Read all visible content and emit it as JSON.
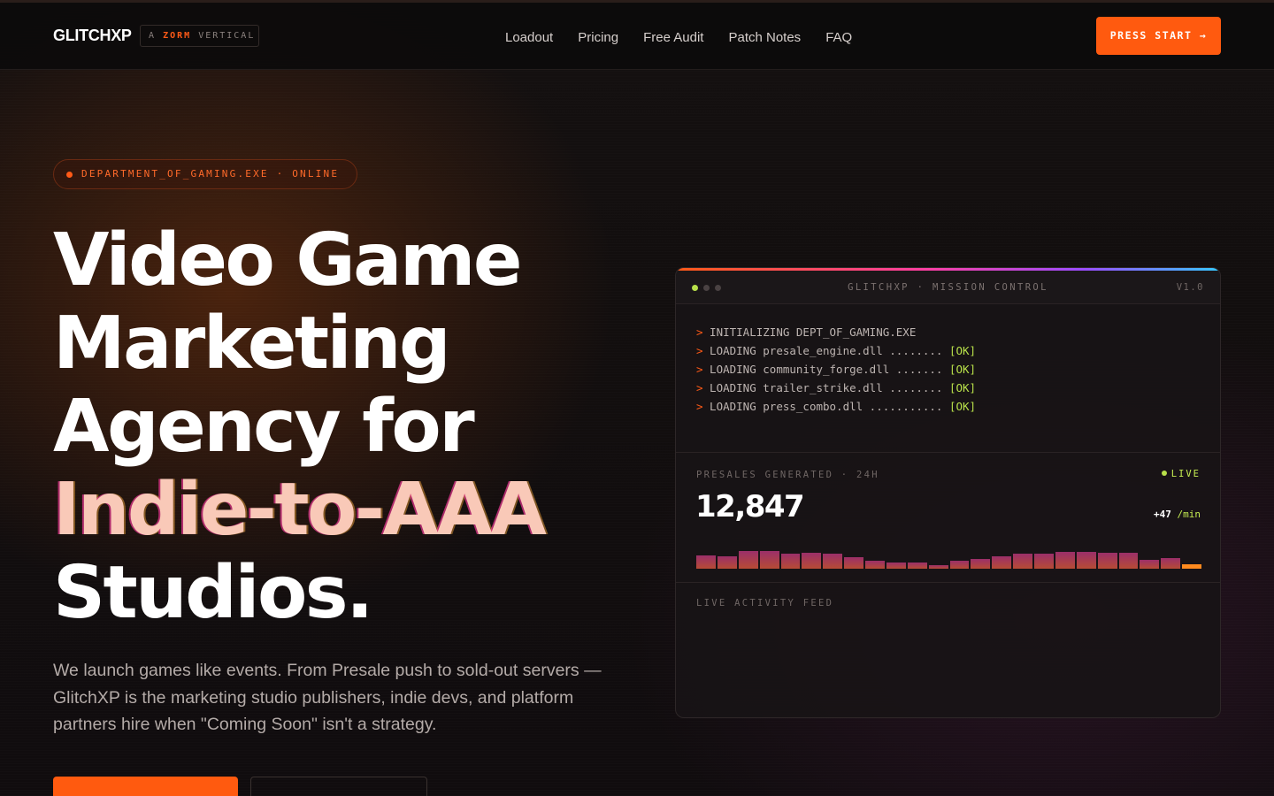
{
  "nav": {
    "logo": "GLITCHXP",
    "badge": {
      "prefix": "A",
      "brand": "ZORM",
      "suffix": "VERTICAL"
    },
    "links": [
      "Loadout",
      "Pricing",
      "Free Audit",
      "Patch Notes",
      "FAQ"
    ],
    "cta": "PRESS START →"
  },
  "hero": {
    "status": "DEPARTMENT_OF_GAMING.EXE · ONLINE",
    "headline": {
      "line1": "Video Game",
      "line2": "Marketing",
      "line3": "Agency for",
      "accent": "Indie-to-AAA",
      "line5": "Studios."
    },
    "subheading": "We launch games like events. From Presale push to sold-out servers — GlitchXP is the marketing studio publishers, indie devs, and platform partners hire when \"Coming Soon\" isn't a strategy."
  },
  "console": {
    "title": "GLITCHXP · MISSION CONTROL",
    "version": "V1.0",
    "log": [
      {
        "prompt": ">",
        "text": " INITIALIZING DEPT_OF_GAMING.EXE",
        "status": ""
      },
      {
        "prompt": ">",
        "text": " LOADING presale_engine.dll ........ ",
        "status": "[OK]"
      },
      {
        "prompt": ">",
        "text": " LOADING community_forge.dll ....... ",
        "status": "[OK]"
      },
      {
        "prompt": ">",
        "text": " LOADING trailer_strike.dll ........ ",
        "status": "[OK]"
      },
      {
        "prompt": ">",
        "text": " LOADING press_combo.dll ........... ",
        "status": "[OK]"
      }
    ],
    "stat": {
      "label": "PRESALES GENERATED · 24H",
      "live": "LIVE",
      "value": "12,847",
      "rate": "+47",
      "rate_unit": "/min"
    },
    "activity_bars": [
      0.62,
      0.58,
      0.82,
      0.85,
      0.72,
      0.74,
      0.7,
      0.56,
      0.38,
      0.3,
      0.3,
      0.18,
      0.36,
      0.44,
      0.6,
      0.7,
      0.7,
      0.78,
      0.78,
      0.74,
      0.74,
      0.42,
      0.48,
      0.22
    ],
    "feed_label": "LIVE ACTIVITY FEED"
  },
  "colors": {
    "accent": "#ff5a0f",
    "live": "#c6ee52",
    "bar_top": "#b23478",
    "bar_bottom": "#d2553a",
    "bar_active": "#ff8a1f"
  }
}
